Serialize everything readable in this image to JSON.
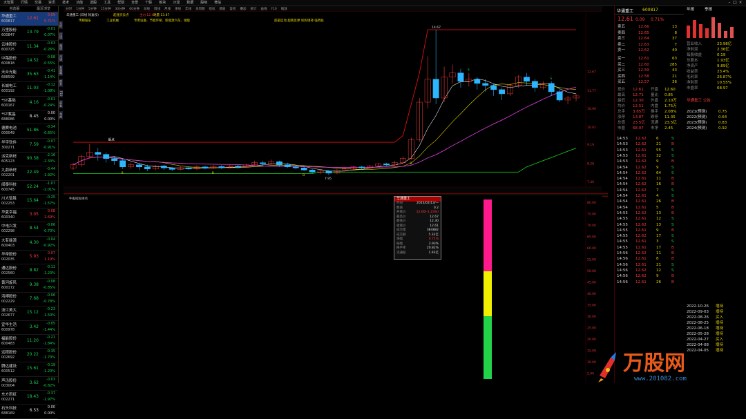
{
  "menu": {
    "items": [
      "大智慧",
      "行情",
      "交易",
      "资讯",
      "技术",
      "功能",
      "选股",
      "工具",
      "帮助",
      "全景",
      "个股",
      "板块",
      "沙漠",
      "数据",
      "股吧",
      "微信"
    ],
    "window_buttons": [
      "–",
      "□",
      "×"
    ]
  },
  "sidebar": {
    "tabs": [
      "自选股",
      "最近浏览"
    ],
    "stocks": [
      {
        "name": "华通重工",
        "code": "600817",
        "price": "12.61",
        "change": "0.09",
        "pct": "0.71%",
        "color": "red"
      },
      {
        "name": "万里股份",
        "code": "600847",
        "price": "13.79",
        "change": "-0.01",
        "pct": "-0.07%",
        "color": "grn"
      },
      {
        "name": "云维股份",
        "code": "600725",
        "price": "11.34",
        "change": "-0.03",
        "pct": "-0.26%",
        "color": "grn"
      },
      {
        "name": "中路股份",
        "code": "600818",
        "price": "14.52",
        "change": "-0.08",
        "pct": "-0.55%",
        "color": "grn"
      },
      {
        "name": "天合光能",
        "code": "688599",
        "price": "35.63",
        "change": "-0.41",
        "pct": "-1.14%",
        "color": "grn"
      },
      {
        "name": "长城电工",
        "code": "600192",
        "price": "11.03",
        "change": "-0.12",
        "pct": "-1.08%",
        "color": "grn"
      },
      {
        "name": "*ST基础",
        "code": "600167",
        "price": "4.16",
        "change": "-0.01",
        "pct": "-0.24%",
        "color": "grn"
      },
      {
        "name": "*ST紫晶",
        "code": "688086",
        "price": "8.45",
        "change": "0.00",
        "pct": "0.00%",
        "color": "wht"
      },
      {
        "name": "德赛电池",
        "code": "000049",
        "price": "51.86",
        "change": "-0.34",
        "pct": "-0.65%",
        "color": "grn"
      },
      {
        "name": "华宇软件",
        "code": "300271",
        "price": "7.59",
        "change": "-0.07",
        "pct": "-0.91%",
        "color": "grn"
      },
      {
        "name": "派克新材",
        "code": "605123",
        "price": "90.58",
        "change": "-2.16",
        "pct": "-2.33%",
        "color": "grn"
      },
      {
        "name": "九鼎新材",
        "code": "002201",
        "price": "22.49",
        "change": "-0.44",
        "pct": "-1.92%",
        "color": "grn"
      },
      {
        "name": "闻泰科技",
        "code": "600745",
        "price": "52.24",
        "change": "-1.07",
        "pct": "-2.01%",
        "color": "grn"
      },
      {
        "name": "川大智胜",
        "code": "002253",
        "price": "15.64",
        "change": "-0.25",
        "pct": "-1.57%",
        "color": "grn"
      },
      {
        "name": "华夏幸福",
        "code": "600340",
        "price": "3.05",
        "change": "0.08",
        "pct": "2.69%",
        "color": "red"
      },
      {
        "name": "中电兴发",
        "code": "002298",
        "price": "8.54",
        "change": "-0.06",
        "pct": "-0.70%",
        "color": "grn"
      },
      {
        "name": "大有能源",
        "code": "600403",
        "price": "4.30",
        "change": "-0.04",
        "pct": "-0.92%",
        "color": "grn"
      },
      {
        "name": "华帝股份",
        "code": "002035",
        "price": "5.93",
        "change": "0.07",
        "pct": "1.19%",
        "color": "red"
      },
      {
        "name": "通达股份",
        "code": "002560",
        "price": "8.82",
        "change": "-0.11",
        "pct": "-1.23%",
        "color": "grn"
      },
      {
        "name": "黄河旋风",
        "code": "600172",
        "price": "9.38",
        "change": "-0.08",
        "pct": "-0.85%",
        "color": "grn"
      },
      {
        "name": "鸿博股份",
        "code": "002229",
        "price": "7.68",
        "change": "-0.06",
        "pct": "-0.78%",
        "color": "grn"
      },
      {
        "name": "浙江美大",
        "code": "002677",
        "price": "15.12",
        "change": "-0.23",
        "pct": "-1.50%",
        "color": "grn"
      },
      {
        "name": "宜华生活",
        "code": "600978",
        "price": "3.42",
        "change": "-0.05",
        "pct": "-1.44%",
        "color": "grn"
      },
      {
        "name": "福能股份",
        "code": "600483",
        "price": "11.20",
        "change": "-0.21",
        "pct": "-1.84%",
        "color": "grn"
      },
      {
        "name": "远程股份",
        "code": "002692",
        "price": "20.22",
        "change": "-0.35",
        "pct": "-1.70%",
        "color": "grn"
      },
      {
        "name": "腾达建设",
        "code": "600512",
        "price": "15.61",
        "change": "-0.19",
        "pct": "-1.20%",
        "color": "grn"
      },
      {
        "name": "声迅股份",
        "code": "003004",
        "price": "3.62",
        "change": "-0.03",
        "pct": "-0.82%",
        "color": "grn"
      },
      {
        "name": "东方雨虹",
        "code": "002271",
        "price": "18.43",
        "change": "-0.37",
        "pct": "-1.97%",
        "color": "grn"
      },
      {
        "name": "石头科技",
        "code": "688169",
        "price": "6.53",
        "change": "0.00",
        "pct": "0.00%",
        "color": "wht"
      }
    ]
  },
  "vtabs": [
    "分时",
    "日线",
    "周线",
    "月线",
    "多周期",
    "财务",
    "F10",
    "资金",
    "龙虎"
  ],
  "chartbar": {
    "items": [
      "分时",
      "1分钟",
      "5分钟",
      "15分钟",
      "30分钟",
      "60分钟",
      "日线",
      "周线",
      "月线",
      "季线",
      "年线",
      "多周期",
      "指标",
      "模板",
      "复权",
      "叠加",
      "统计",
      "画线",
      "F10",
      "缩放"
    ],
    "title": "华通重工 (日线 除复权)",
    "indicator1": "起涨买卖点",
    "highlight": "主力 12.47",
    "tag2": "地量 13.87",
    "sector_text": [
      "传媒娱乐",
      "工业机械",
      "专用设备、节能环保、新能源汽车、储能"
    ],
    "signal_text": "底部启动 超跌反弹 机构增持 强势股"
  },
  "main_chart": {
    "price_axis": [
      "12.67",
      "11.77",
      "10.90",
      "10.01",
      "9.19",
      "8.28",
      "7.40"
    ],
    "high_label": "14.67",
    "low_label": "7.95",
    "candles": [
      [
        8.05,
        8.2,
        7.95,
        8.3
      ],
      [
        8.2,
        8.6,
        8.1,
        8.7
      ],
      [
        8.6,
        8.8,
        8.5,
        9.2
      ],
      [
        8.8,
        8.7,
        8.4,
        9.0
      ],
      [
        8.7,
        8.5,
        8.3,
        8.8
      ],
      [
        8.5,
        8.4,
        8.2,
        8.6
      ],
      [
        8.4,
        8.1,
        8.0,
        8.5
      ],
      [
        8.1,
        8.2,
        8.0,
        8.3
      ],
      [
        8.2,
        8.1,
        7.95,
        8.3
      ],
      [
        8.1,
        8.0,
        7.9,
        8.2
      ],
      [
        8.0,
        8.15,
        7.95,
        8.2
      ],
      [
        8.15,
        8.05,
        7.95,
        8.2
      ],
      [
        8.05,
        7.98,
        7.9,
        8.1
      ],
      [
        7.98,
        8.06,
        7.93,
        8.12
      ],
      [
        8.06,
        8.0,
        7.95,
        8.12
      ],
      [
        8.0,
        8.1,
        7.95,
        8.18
      ],
      [
        8.1,
        8.04,
        7.98,
        8.15
      ],
      [
        8.04,
        8.12,
        8.0,
        8.2
      ],
      [
        8.12,
        8.06,
        8.0,
        8.18
      ],
      [
        8.06,
        8.14,
        8.02,
        8.2
      ],
      [
        8.14,
        8.08,
        8.02,
        8.2
      ],
      [
        8.08,
        8.2,
        8.05,
        8.25
      ],
      [
        8.2,
        8.3,
        8.15,
        8.4
      ],
      [
        8.3,
        8.25,
        8.15,
        8.4
      ],
      [
        8.25,
        8.35,
        8.2,
        8.45
      ],
      [
        8.35,
        8.2,
        8.1,
        8.4
      ],
      [
        8.2,
        8.1,
        8.05,
        8.3
      ],
      [
        8.1,
        8.05,
        7.98,
        8.2
      ],
      [
        8.05,
        7.95,
        7.9,
        8.1
      ],
      [
        7.95,
        7.85,
        7.8,
        8.0
      ],
      [
        7.85,
        7.9,
        7.75,
        7.98
      ],
      [
        7.9,
        7.8,
        7.7,
        7.95
      ],
      [
        7.8,
        7.95,
        7.75,
        8.0
      ],
      [
        7.95,
        8.0,
        7.9,
        8.1
      ],
      [
        8.0,
        8.1,
        7.95,
        8.15
      ],
      [
        8.1,
        8.05,
        7.98,
        8.15
      ],
      [
        8.05,
        8.15,
        8.0,
        8.2
      ],
      [
        8.15,
        8.25,
        8.1,
        8.3
      ],
      [
        8.25,
        8.2,
        8.12,
        8.3
      ],
      [
        8.2,
        8.3,
        8.15,
        8.4
      ],
      [
        8.3,
        8.5,
        8.25,
        8.6
      ],
      [
        8.5,
        9.4,
        8.45,
        9.5
      ],
      [
        9.4,
        11.2,
        9.3,
        11.4
      ],
      [
        11.2,
        12.3,
        10.9,
        13.4
      ],
      [
        12.3,
        11.4,
        11.1,
        14.67
      ],
      [
        11.4,
        12.4,
        11.2,
        12.9
      ],
      [
        12.4,
        12.6,
        12.1,
        13.0
      ],
      [
        12.6,
        12.2,
        11.9,
        12.8
      ],
      [
        12.2,
        12.3,
        11.95,
        12.6
      ],
      [
        12.3,
        12.1,
        11.8,
        12.4
      ],
      [
        12.1,
        12.0,
        11.7,
        12.3
      ],
      [
        12.0,
        11.8,
        11.5,
        12.1
      ],
      [
        11.8,
        11.6,
        11.3,
        11.9
      ],
      [
        11.6,
        12.0,
        11.5,
        12.1
      ],
      [
        12.0,
        12.4,
        11.9,
        12.5
      ],
      [
        12.4,
        12.2,
        12.0,
        12.6
      ],
      [
        12.2,
        11.9,
        11.7,
        12.3
      ],
      [
        11.9,
        12.1,
        11.8,
        12.2
      ],
      [
        12.1,
        11.7,
        11.5,
        12.2
      ],
      [
        11.7,
        11.3,
        11.2,
        11.8
      ],
      [
        11.3,
        11.4,
        11.1,
        11.5
      ],
      [
        11.4,
        11.5,
        11.25,
        11.6
      ]
    ],
    "labels": {
      "buy": "B",
      "sell": "S",
      "start": "起点"
    }
  },
  "sub_chart": {
    "title": "牛股指标拐点",
    "axis": [
      "80.00",
      "75.00",
      "70.00",
      "65.00",
      "60.00",
      "55.00",
      "50.00",
      "45.00",
      "40.00",
      "35.00",
      "30.00",
      "25.00",
      "20.00",
      "15.00",
      "10.00",
      "5.00"
    ],
    "bar_segments": [
      {
        "from": 0,
        "to": 0.4,
        "color": "#ff1a8c"
      },
      {
        "from": 0.4,
        "to": 0.65,
        "color": "#f0f000"
      },
      {
        "from": 0.65,
        "to": 1.0,
        "color": "#22d34a"
      }
    ]
  },
  "popup": {
    "title": "华通重工",
    "rows": [
      [
        "时间",
        "2023/02/13/一"
      ],
      [
        "数值",
        "0.2"
      ],
      [
        "开盘价",
        "12.60(-1.23%)"
      ],
      [
        "最高价",
        "12.67"
      ],
      [
        "最低价",
        "12.30"
      ],
      [
        "收盘价",
        "12.61"
      ],
      [
        "成交量",
        "384882"
      ],
      [
        "成交额",
        "5.32亿"
      ],
      [
        "涨幅",
        "0.71%"
      ],
      [
        "振幅",
        "2.93%"
      ],
      [
        "换手率",
        "20.82%"
      ],
      [
        "流通股",
        "1.93亿"
      ]
    ]
  },
  "right_panel": {
    "header": {
      "name": "华通重工",
      "code": "600817"
    },
    "price": {
      "last": "12.61",
      "change": "0.09",
      "pct": "0.71%"
    },
    "sells": [
      [
        "卖五",
        "12.66",
        "13"
      ],
      [
        "卖四",
        "12.65",
        "8"
      ],
      [
        "卖三",
        "12.64",
        "37"
      ],
      [
        "卖二",
        "12.63",
        "7"
      ],
      [
        "卖一",
        "12.62",
        "40"
      ]
    ],
    "buys": [
      [
        "买一",
        "12.61",
        "63"
      ],
      [
        "买二",
        "12.60",
        "285"
      ],
      [
        "买三",
        "12.59",
        "43"
      ],
      [
        "买四",
        "12.58",
        "21"
      ],
      [
        "买五",
        "12.57",
        "36"
      ]
    ],
    "stats": [
      [
        "现价",
        "12.61",
        "开盘",
        "12.60"
      ],
      [
        "最高",
        "12.71",
        "量比",
        "0.85"
      ],
      [
        "最低",
        "12.30",
        "外盘",
        "2.10万"
      ],
      [
        "均价",
        "12.51",
        "内盘",
        "1.75万"
      ],
      [
        "总手",
        "3.85万",
        "换手",
        "2.08%"
      ],
      [
        "涨停",
        "13.87",
        "跌停",
        "11.35"
      ],
      [
        "总值",
        "23.5亿",
        "流通",
        "23.5亿"
      ],
      [
        "市盈",
        "68.97",
        "市净",
        "2.45"
      ]
    ],
    "ticks": [
      [
        "14:53",
        "12.62",
        "6",
        "S"
      ],
      [
        "14:53",
        "12.62",
        "21",
        "B"
      ],
      [
        "14:53",
        "12.61",
        "55",
        "S"
      ],
      [
        "14:53",
        "12.61",
        "32",
        "S"
      ],
      [
        "14:53",
        "12.62",
        "9",
        "B"
      ],
      [
        "14:54",
        "12.62",
        "9",
        "S"
      ],
      [
        "14:54",
        "12.62",
        "64",
        "S"
      ],
      [
        "14:54",
        "12.61",
        "11",
        "B"
      ],
      [
        "14:54",
        "12.62",
        "16",
        "B"
      ],
      [
        "14:54",
        "12.62",
        "7",
        "S"
      ],
      [
        "14:54",
        "12.61",
        "4",
        "S"
      ],
      [
        "14:54",
        "12.61",
        "26",
        "B"
      ],
      [
        "14:54",
        "12.61",
        "5",
        "B"
      ],
      [
        "14:55",
        "12.62",
        "13",
        "B"
      ],
      [
        "14:55",
        "12.61",
        "12",
        "S"
      ],
      [
        "14:55",
        "12.62",
        "13",
        "S"
      ],
      [
        "14:55",
        "12.61",
        "9",
        "B"
      ],
      [
        "14:55",
        "12.62",
        "17",
        "S"
      ],
      [
        "14:55",
        "12.61",
        "3",
        "S"
      ],
      [
        "14:55",
        "12.61",
        "17",
        "B"
      ],
      [
        "14:56",
        "12.62",
        "11",
        "B"
      ],
      [
        "14:56",
        "12.61",
        "8",
        "B"
      ],
      [
        "14:56",
        "12.61",
        "21",
        "S"
      ],
      [
        "14:56",
        "12.62",
        "12",
        "S"
      ],
      [
        "14:56",
        "12.62",
        "9",
        "B"
      ],
      [
        "14:56",
        "12.61",
        "26",
        "B"
      ]
    ],
    "info_tabs": [
      "年报",
      "季报"
    ],
    "info": [
      [
        "营业收入",
        "23.98亿"
      ],
      [
        "净利润",
        "2.36亿"
      ],
      [
        "每股收益",
        "0.19"
      ],
      [
        "总股本",
        "1.93亿"
      ],
      [
        "净资产",
        "9.89亿"
      ],
      [
        "收益率",
        "23.4%"
      ],
      [
        "毛利率",
        "26.87%"
      ],
      [
        "净利率",
        "10.55%"
      ],
      [
        "市盈率",
        "68.97"
      ]
    ],
    "news_title": "华通重工 公告",
    "news": [
      [
        "2022-10-26",
        "增持"
      ],
      [
        "2022-09-03",
        "增持"
      ],
      [
        "2022-08-26",
        "买入"
      ],
      [
        "2022-08-25",
        "增持"
      ],
      [
        "2022-06-18",
        "增持"
      ],
      [
        "2022-05-28",
        "增持"
      ],
      [
        "2022-04-27",
        "买入"
      ],
      [
        "2022-04-08",
        "增持"
      ],
      [
        "2022-04-05",
        "增持"
      ]
    ],
    "forecast": [
      [
        "2021(预测)",
        "0.75"
      ],
      [
        "2022(预测)",
        "0.64"
      ],
      [
        "2023(预测)",
        "0.83"
      ],
      [
        "2024(预测)",
        "0.92"
      ]
    ]
  },
  "watermark": {
    "text": "万股网",
    "url": "www.201082.com"
  },
  "colors": {
    "up": "#ff3b3b",
    "down": "#19d34f",
    "ma_magenta": "#d23ad2",
    "ma_white": "#e6e6e6",
    "ma_yellow": "#e6d600",
    "line_red": "#e01010",
    "line_green": "#17c317",
    "candle_cyan": "#2bb6ff"
  }
}
